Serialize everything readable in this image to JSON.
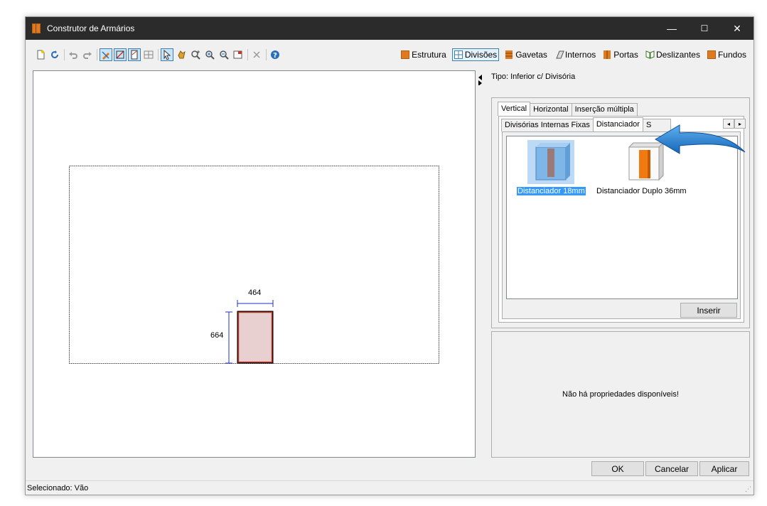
{
  "window": {
    "title": "Construtor de Armários",
    "controls": {
      "minimize": "—",
      "maximize": "☐",
      "close": "✕"
    }
  },
  "toolbar": {
    "modes": [
      {
        "label": "Estrutura",
        "icon": "cabinet-structure-icon",
        "color": "#e07a1f"
      },
      {
        "label": "Divisões",
        "icon": "grid-divisions-icon",
        "color": "#3c7fb1",
        "active": true
      },
      {
        "label": "Gavetas",
        "icon": "drawer-icon",
        "color": "#e07a1f"
      },
      {
        "label": "Internos",
        "icon": "internal-panel-icon",
        "color": "#555555"
      },
      {
        "label": "Portas",
        "icon": "door-icon",
        "color": "#e07a1f"
      },
      {
        "label": "Deslizantes",
        "icon": "sliding-door-icon",
        "color": "#3a7a2a"
      },
      {
        "label": "Fundos",
        "icon": "back-panel-icon",
        "color": "#e07a1f"
      }
    ]
  },
  "drawing": {
    "width_dimension": "464",
    "height_dimension": "664"
  },
  "panel": {
    "tipo": "Tipo: Inferior c/ Divisória",
    "tabs": [
      "Vertical",
      "Horizontal",
      "Inserção múltipla"
    ],
    "subtabs": [
      "Divisórias Internas Fixas",
      "Distanciador",
      "S"
    ],
    "items": [
      {
        "label": "Distanciador 18mm",
        "selected": true
      },
      {
        "label": "Distanciador Duplo 36mm",
        "selected": false
      }
    ],
    "insert_label": "Inserir",
    "no_properties": "Não há propriedades disponíveis!"
  },
  "dialog_buttons": {
    "ok": "OK",
    "cancel": "Cancelar",
    "apply": "Aplicar"
  },
  "status": {
    "text": "Selecionado: Vão"
  },
  "colors": {
    "accent": "#3399ff",
    "callout": "#1e7fd0",
    "piece": "#e8d0d0",
    "piece_border": "#c0392b"
  }
}
